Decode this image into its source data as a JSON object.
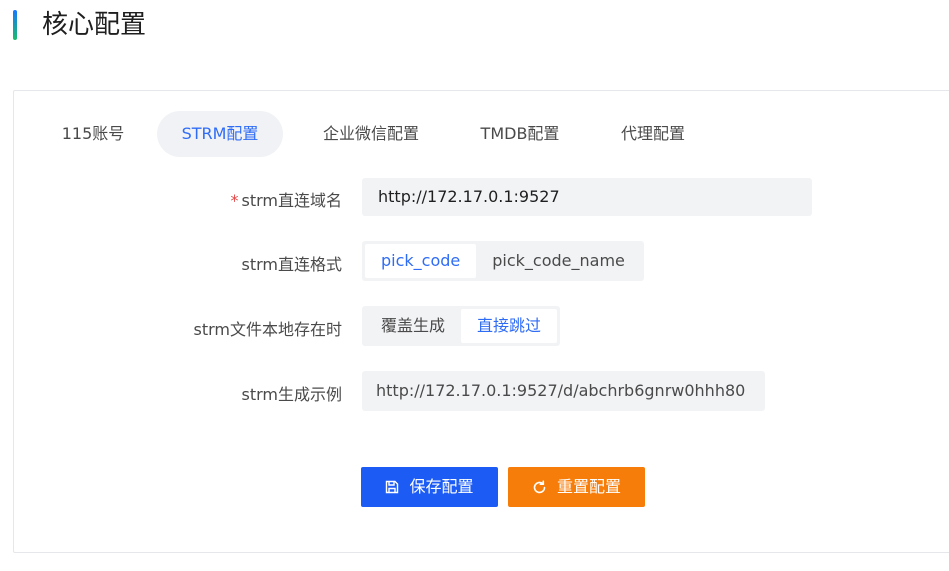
{
  "header": {
    "title": "核心配置",
    "accent_gradient": [
      "#1677ff",
      "#19be6b"
    ]
  },
  "tabs": [
    {
      "label": "115账号",
      "active": false
    },
    {
      "label": "STRM配置",
      "active": true
    },
    {
      "label": "企业微信配置",
      "active": false
    },
    {
      "label": "TMDB配置",
      "active": false
    },
    {
      "label": "代理配置",
      "active": false
    }
  ],
  "form": {
    "domain": {
      "required_mark": "*",
      "label": "strm直连域名",
      "value": "http://172.17.0.1:9527"
    },
    "format": {
      "label": "strm直连格式",
      "options": [
        "pick_code",
        "pick_code_name"
      ],
      "selected": "pick_code"
    },
    "local_exists": {
      "label": "strm文件本地存在时",
      "options": [
        "覆盖生成",
        "直接跳过"
      ],
      "selected": "直接跳过"
    },
    "example": {
      "label": "strm生成示例",
      "value": "http://172.17.0.1:9527/d/abchrb6gnrw0hhh80"
    }
  },
  "actions": {
    "save": {
      "label": "保存配置",
      "icon": "save-icon",
      "color": "#1c5cf4"
    },
    "reset": {
      "label": "重置配置",
      "icon": "refresh-icon",
      "color": "#f77d0a"
    }
  },
  "colors": {
    "accent": "#2f6cf6",
    "required": "#e64545"
  }
}
